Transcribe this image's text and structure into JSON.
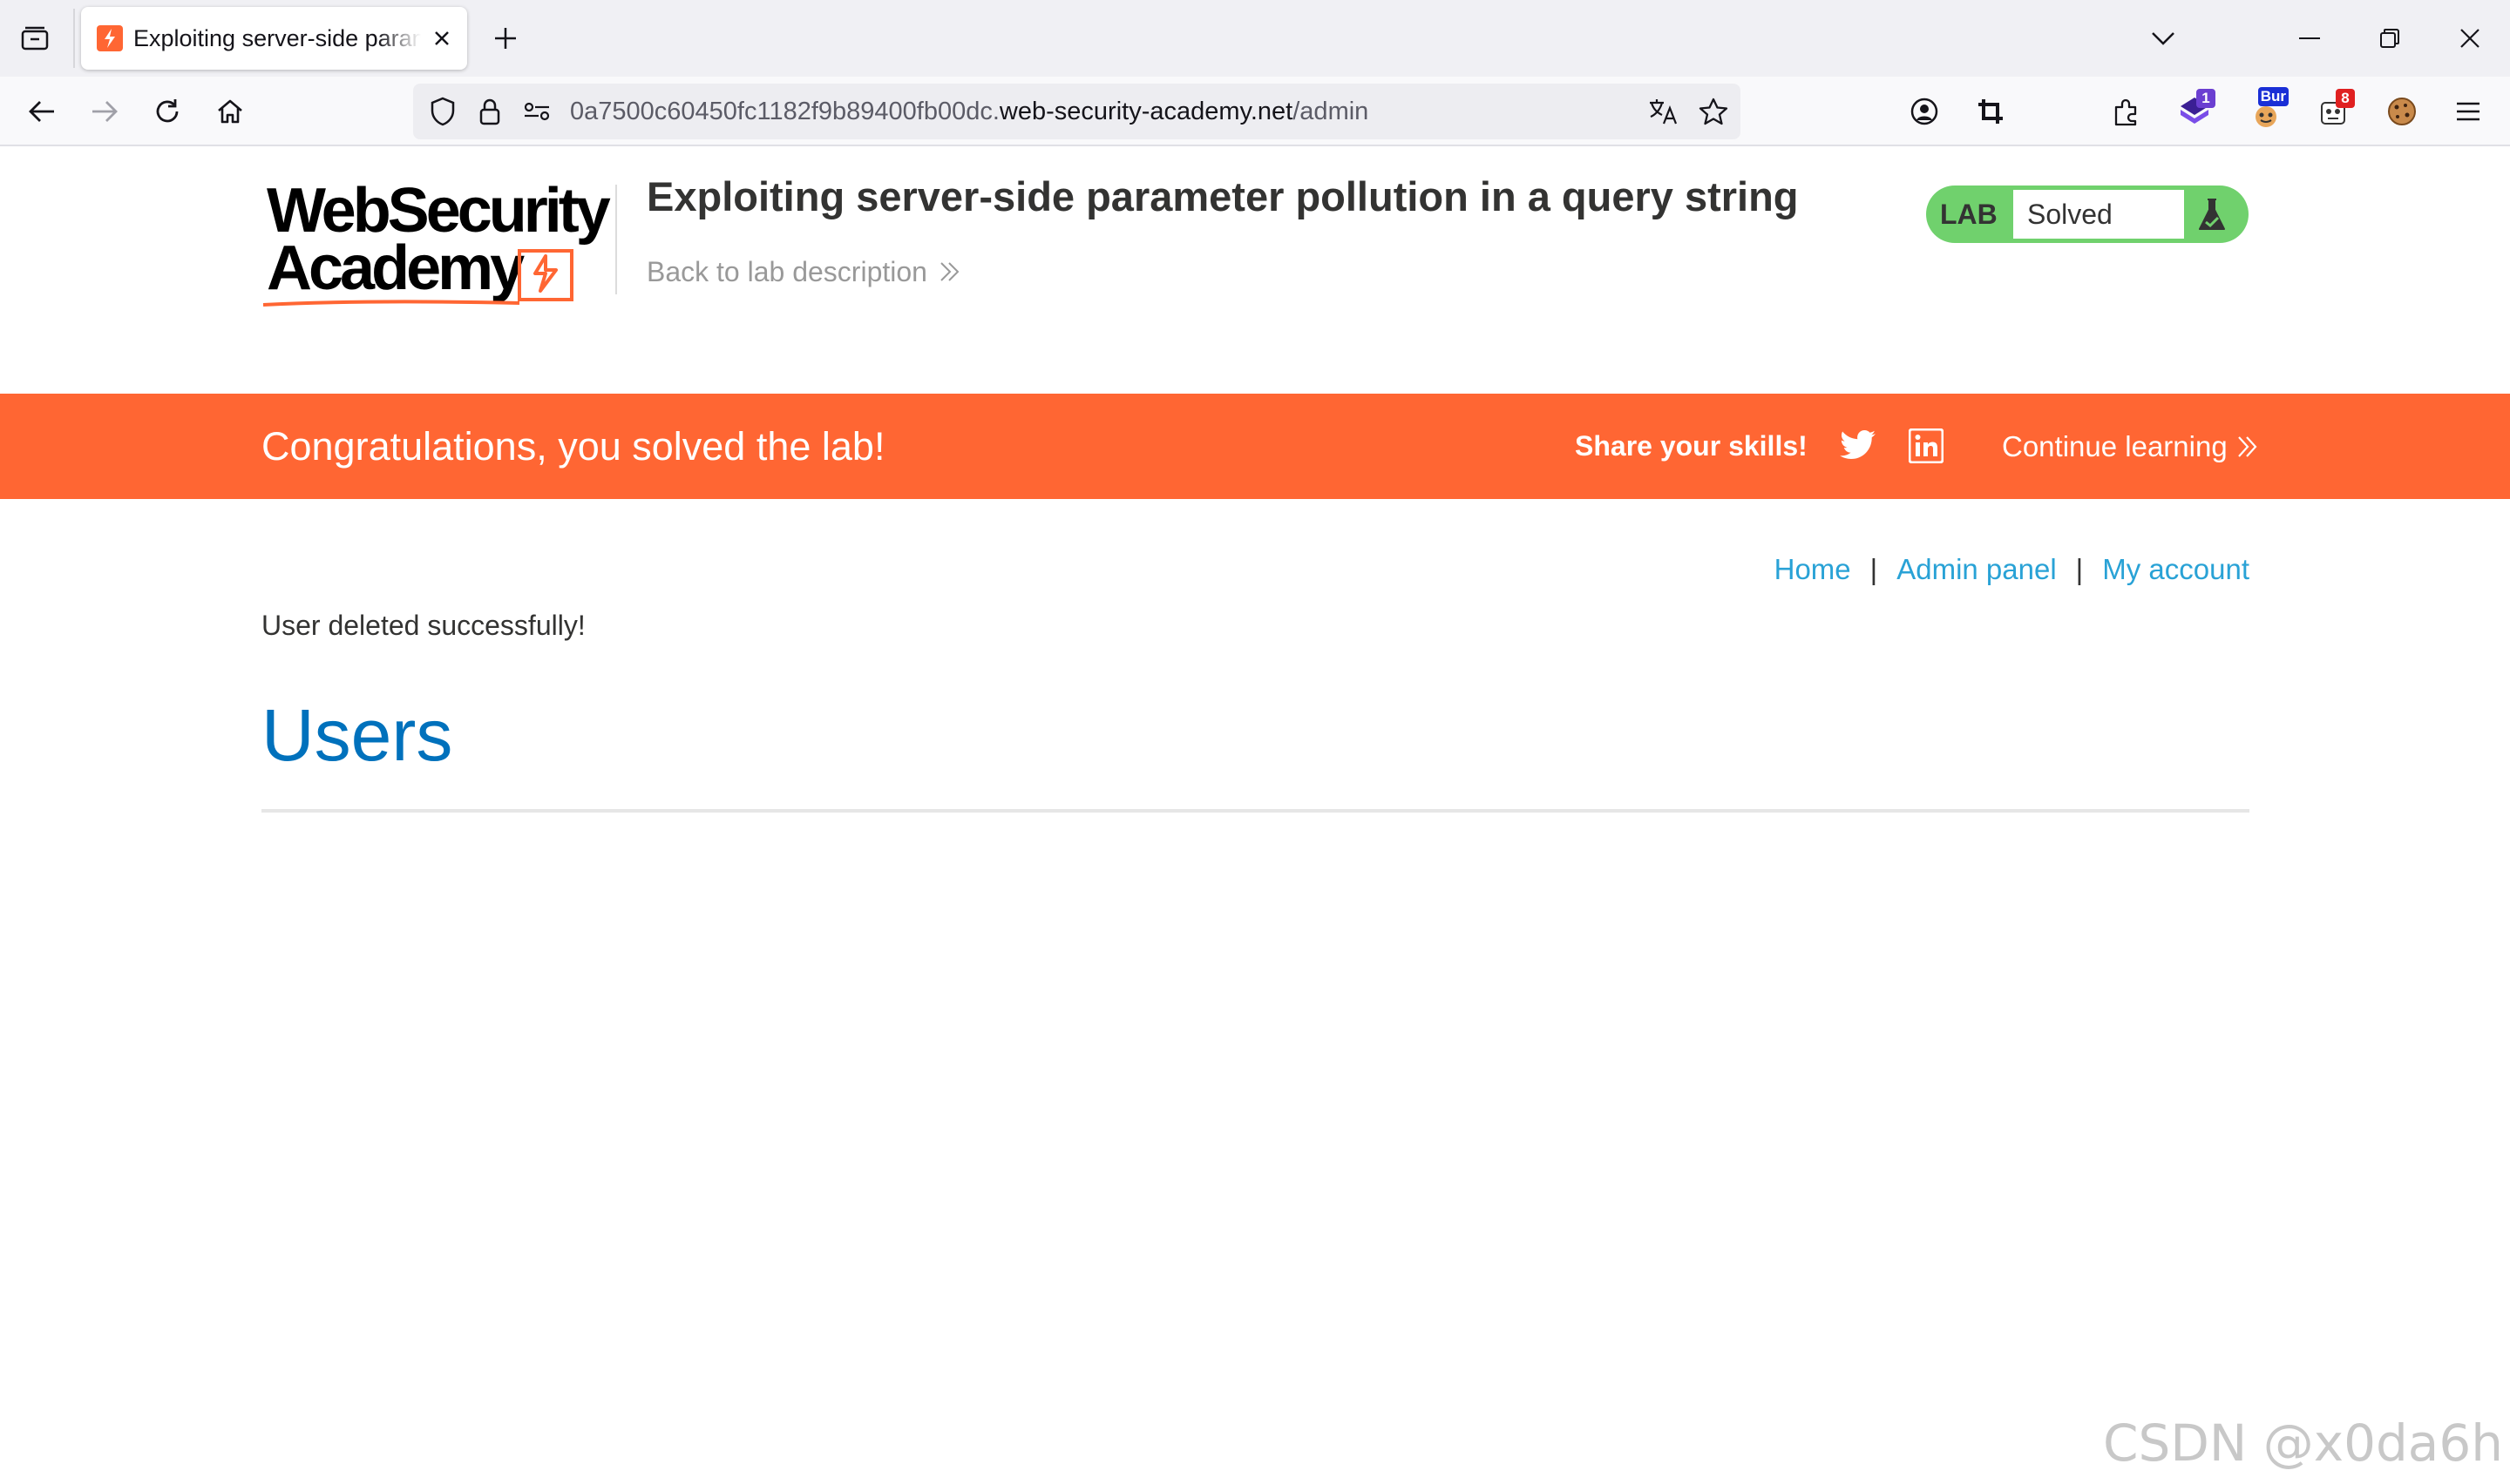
{
  "browser": {
    "tab_title": "Exploiting server-side parameter pollution in a query string",
    "url_prefix": "0a7500c60450fc1182f9b89400fb00dc.",
    "url_host": "web-security-academy.net",
    "url_path": "/admin",
    "extensions": [
      {
        "icon": "extension-1-icon",
        "badge": "1",
        "badge_color": "#6b3fd1"
      },
      {
        "icon": "burp-extension-icon",
        "badge": "Bur",
        "badge_color": "#1a2fd6"
      },
      {
        "icon": "extension-8-icon",
        "badge": "8",
        "badge_color": "#e02020"
      }
    ]
  },
  "header": {
    "logo_line1": "WebSecurity",
    "logo_line2": "Academy",
    "lab_title": "Exploiting server-side parameter pollution in a query string",
    "back_link": "Back to lab description",
    "lab_status_tag": "LAB",
    "lab_status_text": "Solved"
  },
  "banner": {
    "message": "Congratulations, you solved the lab!",
    "share": "Share your skills!",
    "continue": "Continue learning",
    "color": "#ff6633"
  },
  "nav": {
    "home": "Home",
    "admin_panel": "Admin panel",
    "my_account": "My account",
    "separator": "|"
  },
  "content": {
    "message": "User deleted successfully!",
    "heading": "Users"
  },
  "watermark": "CSDN @x0da6h",
  "colors": {
    "accent": "#ff6633",
    "link": "#29a2d6",
    "heading": "#0071bc",
    "solved": "#70d16d"
  }
}
